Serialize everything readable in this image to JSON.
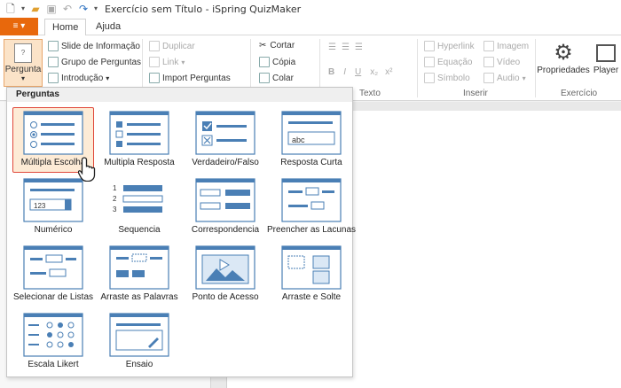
{
  "titlebar": {
    "title": "Exercício sem Título - iSpring QuizMaker"
  },
  "tabs": {
    "file_label": "≡ ▾",
    "home": "Home",
    "help": "Ajuda"
  },
  "ribbon": {
    "pergunta": "Pergunta",
    "slide_info": "Slide de Informação",
    "grupo": "Grupo de Perguntas",
    "intro": "Introdução",
    "duplicar": "Duplicar",
    "link": "Link",
    "import": "Import Perguntas",
    "cortar": "Cortar",
    "copia": "Cópia",
    "colar": "Colar",
    "texto": "Texto",
    "hyperlink": "Hyperlink",
    "equacao": "Equação",
    "simbolo": "Símbolo",
    "imagem": "Imagem",
    "video": "Vídeo",
    "audio": "Audio",
    "inserir": "Inserir",
    "propriedades": "Propriedades",
    "player": "Player",
    "exercicio": "Exercício"
  },
  "dropdown": {
    "header": "Perguntas",
    "items": [
      {
        "label": "Múltipla Escolha"
      },
      {
        "label": "Multipla Resposta"
      },
      {
        "label": "Verdadeiro/Falso"
      },
      {
        "label": "Resposta Curta"
      },
      {
        "label": "Numérico"
      },
      {
        "label": "Sequencia"
      },
      {
        "label": "Correspondencia"
      },
      {
        "label": "Preencher as Lacunas"
      },
      {
        "label": "Selecionar de Listas"
      },
      {
        "label": "Arraste as Palavras"
      },
      {
        "label": "Ponto de Acesso"
      },
      {
        "label": "Arraste e Solte"
      },
      {
        "label": "Escala Likert"
      },
      {
        "label": "Ensaio"
      }
    ],
    "abc_text": "abc",
    "num_text": "123",
    "seq_nums": [
      "1",
      "2",
      "3"
    ]
  },
  "colors": {
    "accent": "#e8680c",
    "frame": "#4a7fb5",
    "selected_border": "#e0483a"
  }
}
